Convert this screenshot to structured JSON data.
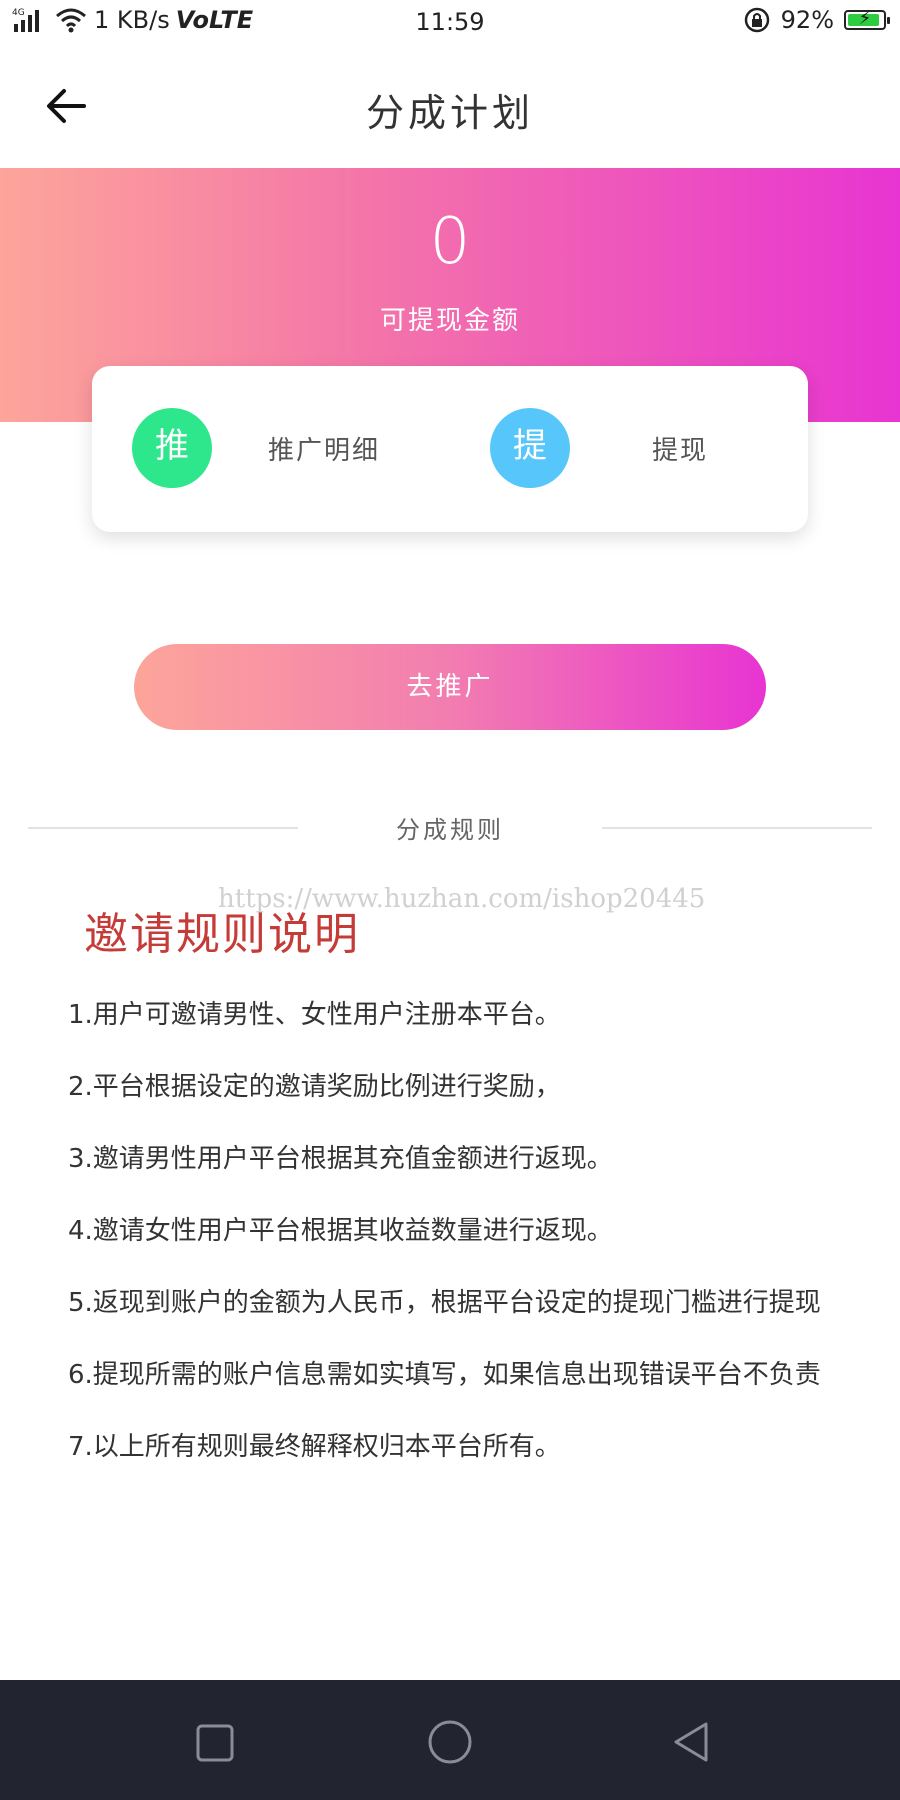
{
  "status_bar": {
    "network": "4G",
    "speed": "1 KB/s",
    "volte": "VoLTE",
    "time": "11:59",
    "battery": "92%",
    "battery_level": 0.92,
    "icons": [
      "signal-icon",
      "wifi-icon",
      "rotation-lock-icon",
      "battery-charging-icon"
    ]
  },
  "header": {
    "title": "分成计划",
    "back_icon": "arrow-left-icon"
  },
  "banner": {
    "amount": "0",
    "amount_label": "可提现金额"
  },
  "actions": [
    {
      "icon_char": "推",
      "label": "推广明细",
      "color": "#2ee68c"
    },
    {
      "icon_char": "提",
      "label": "提现",
      "color": "#57c6fb"
    }
  ],
  "promote_button": "去推广",
  "rules_section": {
    "title": "分成规则",
    "watermark": "https://www.huzhan.com/ishop20445",
    "heading": "邀请规则说明",
    "items": [
      "1.用户可邀请男性、女性用户注册本平台。",
      "2.平台根据设定的邀请奖励比例进行奖励，",
      "3.邀请男性用户平台根据其充值金额进行返现。",
      "4.邀请女性用户平台根据其收益数量进行返现。",
      "5.返现到账户的金额为人民币，根据平台设定的提现门槛进行提现",
      "6.提现所需的账户信息需如实填写，如果信息出现错误平台不负责",
      "7.以上所有规则最终解释权归本平台所有。"
    ]
  },
  "nav_bar": {
    "icons": [
      "square-icon",
      "circle-icon",
      "triangle-back-icon"
    ]
  },
  "colors": {
    "gradient_start": "#fda59a",
    "gradient_end": "#e834d2",
    "heading_red": "#c43b37",
    "nav_bg": "#222530"
  }
}
